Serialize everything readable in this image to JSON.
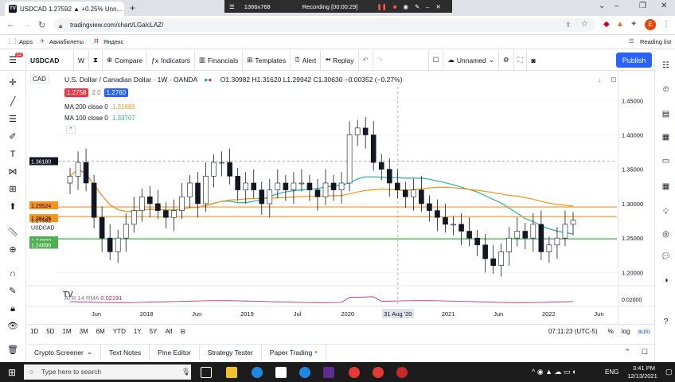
{
  "browser": {
    "tab_title": "USDCAD 1.27592 ▲ +0.25% Unn...",
    "recording": {
      "resolution": "1366x768",
      "status": "Recording [00:00:29]"
    },
    "url": "tradingview.com/chart/LGalcLAZ/",
    "bookmarks": [
      "Apps",
      "Авиабилеты",
      "Яндекс"
    ],
    "reading_list": "Reading list",
    "profile_initial": "E"
  },
  "toolbar": {
    "symbol": "USDCAD",
    "interval": "W",
    "compare": "Compare",
    "indicators": "Indicators",
    "financials": "Financials",
    "templates": "Templates",
    "alert": "Alert",
    "replay": "Replay",
    "layout_name": "Unnamed",
    "publish": "Publish",
    "notification_count": "11"
  },
  "legend": {
    "currency": "CAD",
    "title": "U.S. Dollar / Canadian Dollar · 1W · OANDA",
    "ohlc": "O1.30982 H1.31620 L1.29942 C1.30630 −0.00352 (−0.27%)",
    "sell_price": "1.2758",
    "spread": "2.0",
    "buy_price": "1.2760",
    "ma200_label": "MA 200 close 0",
    "ma200_value": "1.31683",
    "ma100_label": "MA 100 close 0",
    "ma100_value": "1.33707"
  },
  "chart_data": {
    "type": "candlestick",
    "symbol": "USDCAD",
    "interval": "1W",
    "source": "OANDA",
    "y_ticks": [
      "1.45000",
      "1.40000",
      "1.35000",
      "1.30000",
      "1.25000",
      "1.20000"
    ],
    "x_ticks": [
      "Jun",
      "2018",
      "Jun",
      "2019",
      "Jul",
      "2020",
      "31 Aug '20",
      "2021",
      "Jun",
      "2022",
      "Jun"
    ],
    "ylim": [
      1.19,
      1.47
    ],
    "closes": [
      1.34,
      1.36,
      1.33,
      1.28,
      1.25,
      1.23,
      1.25,
      1.27,
      1.29,
      1.31,
      1.3,
      1.29,
      1.28,
      1.29,
      1.31,
      1.33,
      1.3,
      1.34,
      1.36,
      1.36,
      1.34,
      1.32,
      1.33,
      1.32,
      1.3,
      1.32,
      1.33,
      1.32,
      1.33,
      1.33,
      1.32,
      1.31,
      1.33,
      1.32,
      1.33,
      1.4,
      1.41,
      1.4,
      1.36,
      1.35,
      1.33,
      1.32,
      1.31,
      1.32,
      1.3,
      1.29,
      1.28,
      1.27,
      1.27,
      1.26,
      1.25,
      1.24,
      1.22,
      1.21,
      1.23,
      1.25,
      1.26,
      1.25,
      1.27,
      1.23,
      1.24,
      1.25,
      1.27,
      1.276
    ],
    "price_labels": {
      "crosshair": "1.36180",
      "ma100": "1.29524",
      "ma200": "1.28125",
      "last": "1.27592",
      "last_symbol": "USDCAD",
      "level_upper": "1.24899",
      "level_lower": "1.24896"
    },
    "horizontal_lines": [
      1.2952,
      1.2812,
      1.2489
    ],
    "ma_series": [
      {
        "name": "MA 200 close 0",
        "color": "#f7931a"
      },
      {
        "name": "MA 100 close 0",
        "color": "#26b0a8"
      }
    ],
    "atr": {
      "label": "ATR 14 RMA",
      "value": "0.02191",
      "scale": "0.02000"
    }
  },
  "range_bar": {
    "ranges": [
      "1D",
      "5D",
      "1M",
      "3M",
      "6M",
      "YTD",
      "1Y",
      "5Y",
      "All"
    ],
    "time": "07:11:23 (UTC-5)",
    "percent": "%",
    "log": "log",
    "auto": "auto"
  },
  "panel_tabs": [
    "Crypto Screener",
    "Text Notes",
    "Pine Editor",
    "Strategy Tester",
    "Paper Trading"
  ],
  "taskbar": {
    "search_placeholder": "Type here to search",
    "lang": "ENG",
    "time": "3:41 PM",
    "date": "12/13/2021"
  },
  "colors": {
    "accent": "#2962ff",
    "up": "#131722",
    "ma200": "#f7931a",
    "ma100": "#26b0a8",
    "level": "#4caf50"
  }
}
